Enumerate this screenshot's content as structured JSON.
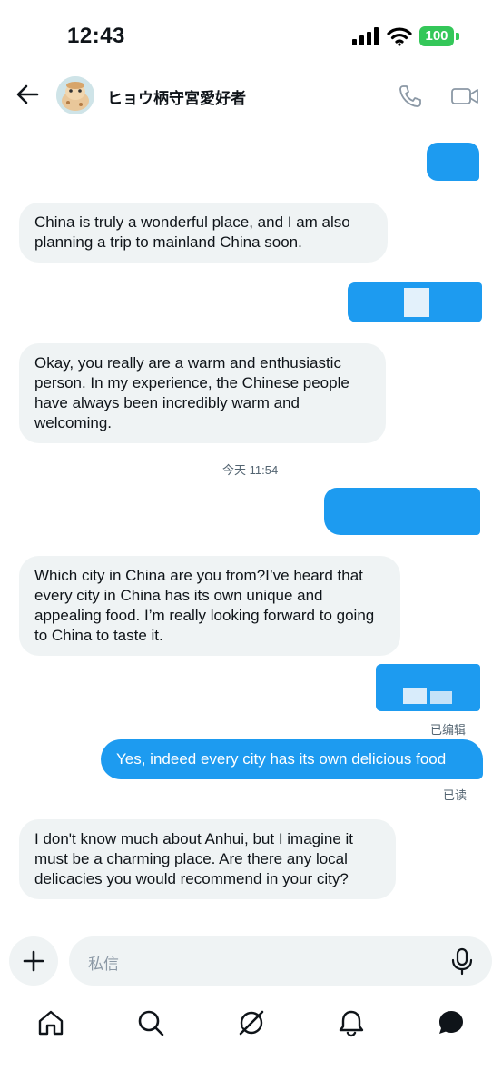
{
  "status": {
    "time": "12:43",
    "battery": "100"
  },
  "header": {
    "contact_name": "ヒョウ柄守宮愛好者"
  },
  "messages": {
    "m1": "China is truly a wonderful place, and I am also planning a trip to mainland China soon.",
    "m2": "Okay, you really are a warm and enthusiastic person. In my experience, the Chinese people have always been incredibly warm and welcoming.",
    "timestamp": "今天 11:54",
    "m3": "Which city in China are you from?I’ve heard that every city in China has its own unique and appealing food. I’m really looking forward to going to China to taste it.",
    "edited_label": "已编辑",
    "m4": "Yes, indeed every city has its own delicious food",
    "read_label": "已读",
    "m5": "I don't know much about Anhui, but I imagine it must be a charming place. Are there any local delicacies you would recommend in your city?"
  },
  "composer": {
    "placeholder": "私信"
  },
  "colors": {
    "accent": "#1d9bf0",
    "incoming_bubble": "#eff3f4",
    "battery": "#34c759"
  },
  "nav": {
    "items": [
      "home-icon",
      "search-icon",
      "grok-icon",
      "notifications-icon",
      "messages-icon"
    ]
  }
}
